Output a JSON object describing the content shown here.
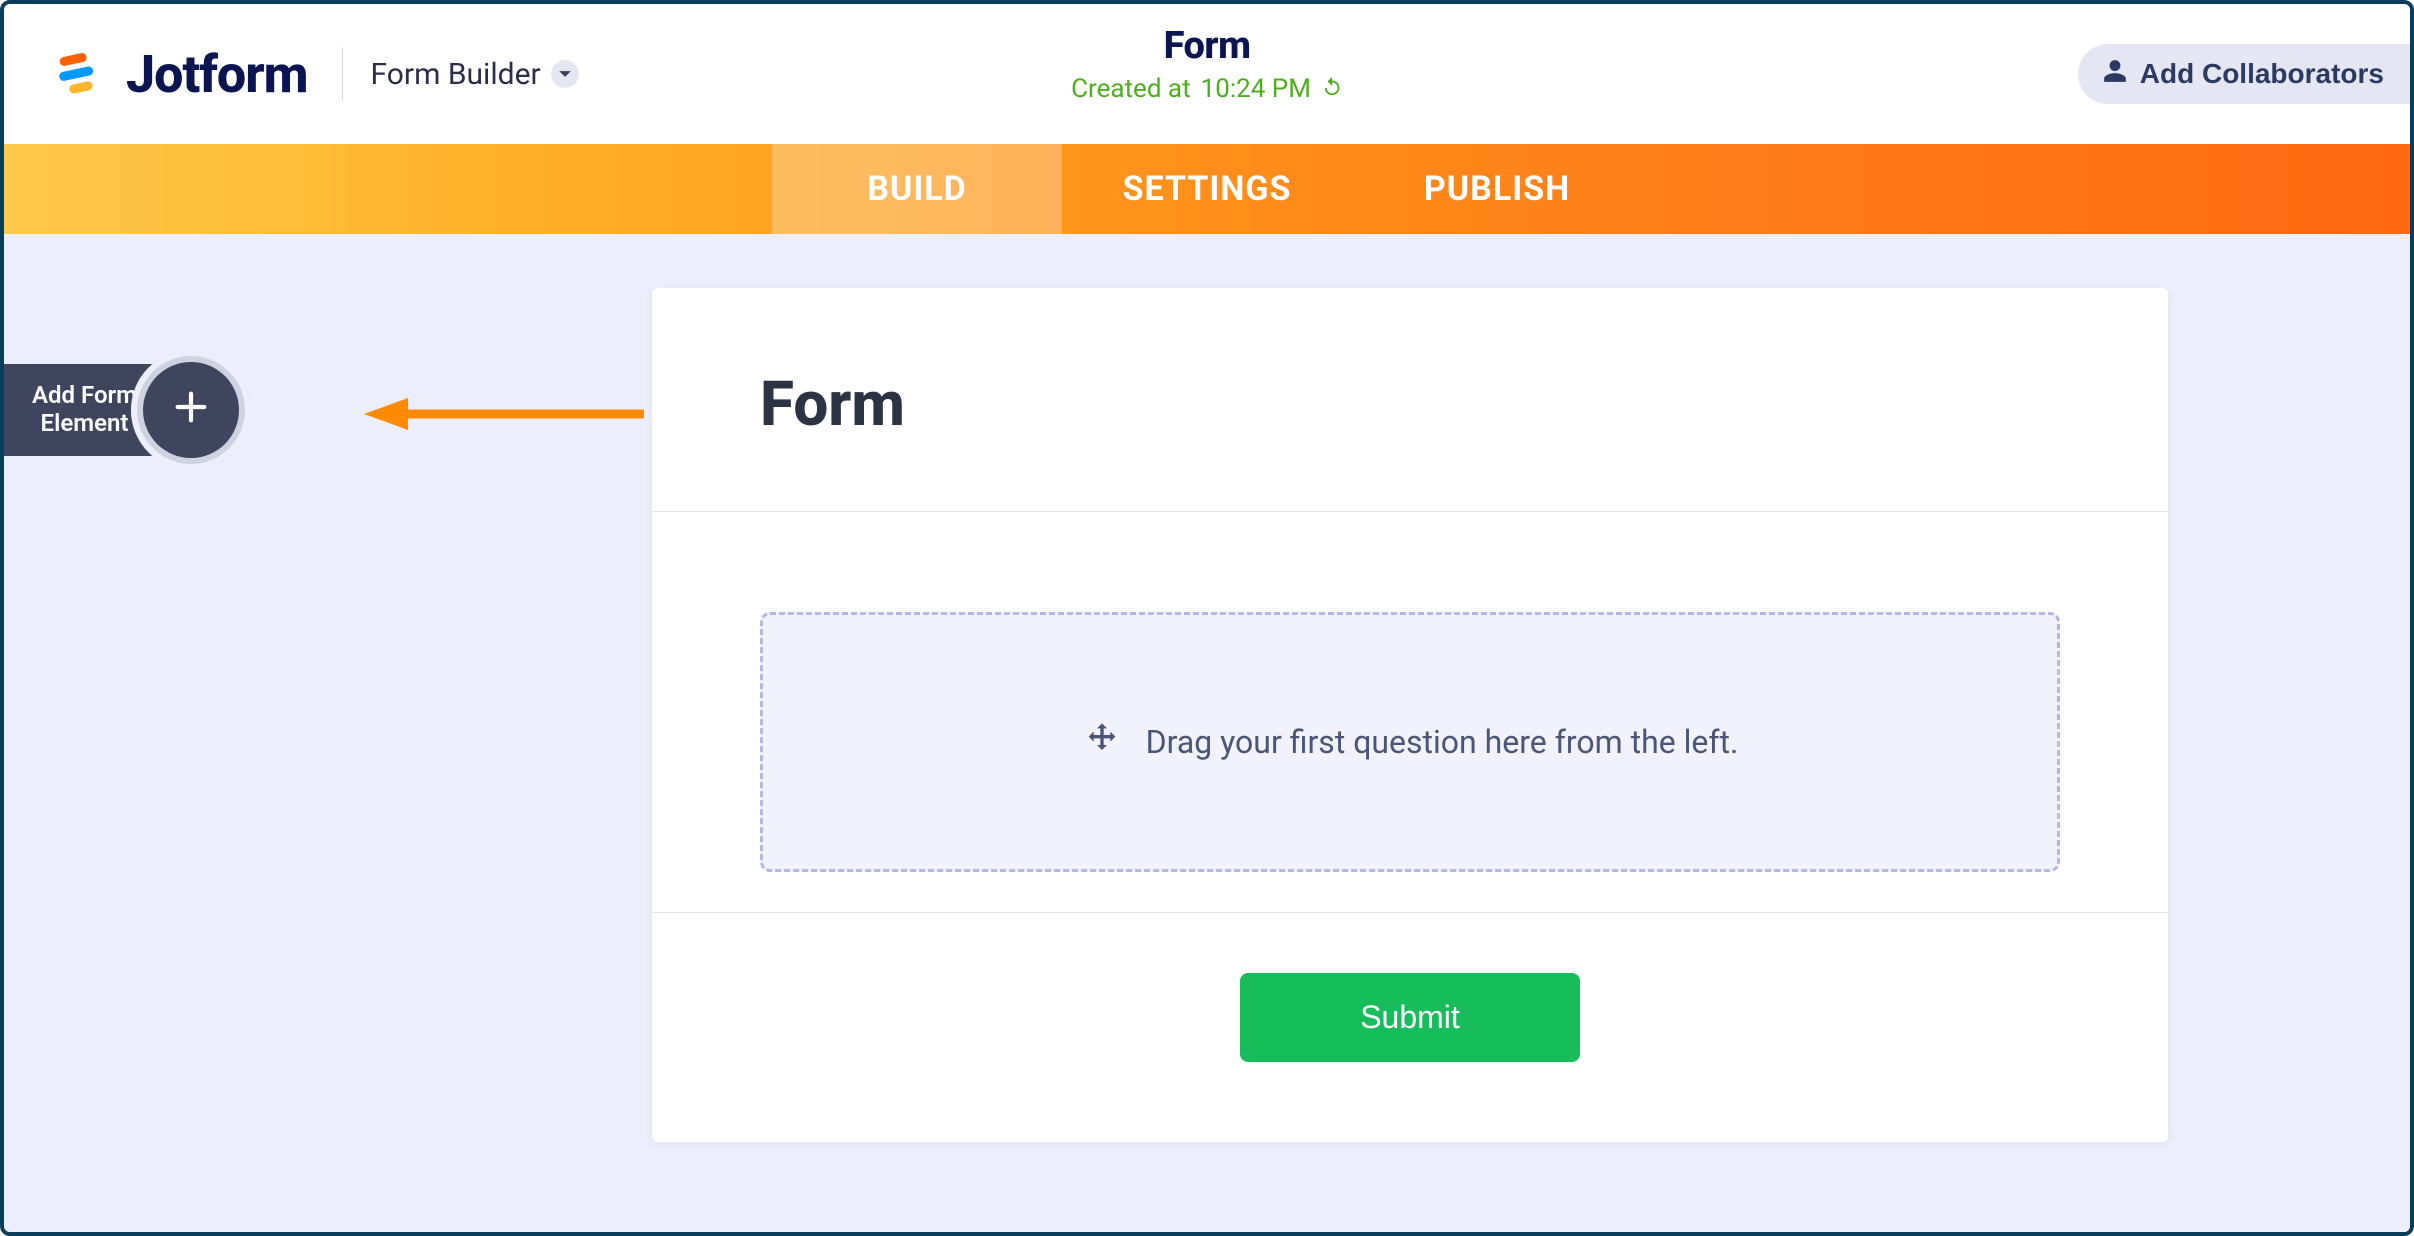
{
  "brand": {
    "name": "Jotform"
  },
  "header": {
    "builder_label": "Form Builder",
    "title": "Form",
    "status_prefix": "Created at ",
    "status_time": "10:24 PM",
    "collab_label": "Add Collaborators"
  },
  "tabs": {
    "build": "BUILD",
    "settings": "SETTINGS",
    "publish": "PUBLISH",
    "active": "build"
  },
  "sidebar": {
    "add_element_line1": "Add Form",
    "add_element_line2": "Element"
  },
  "form": {
    "title": "Form",
    "drop_hint": "Drag your first question here from the left.",
    "submit_label": "Submit"
  },
  "colors": {
    "brand_blue": "#0a1551",
    "accent_green": "#4caf1d",
    "submit_green": "#18bd5b",
    "annotation_orange": "#ff8a00"
  }
}
